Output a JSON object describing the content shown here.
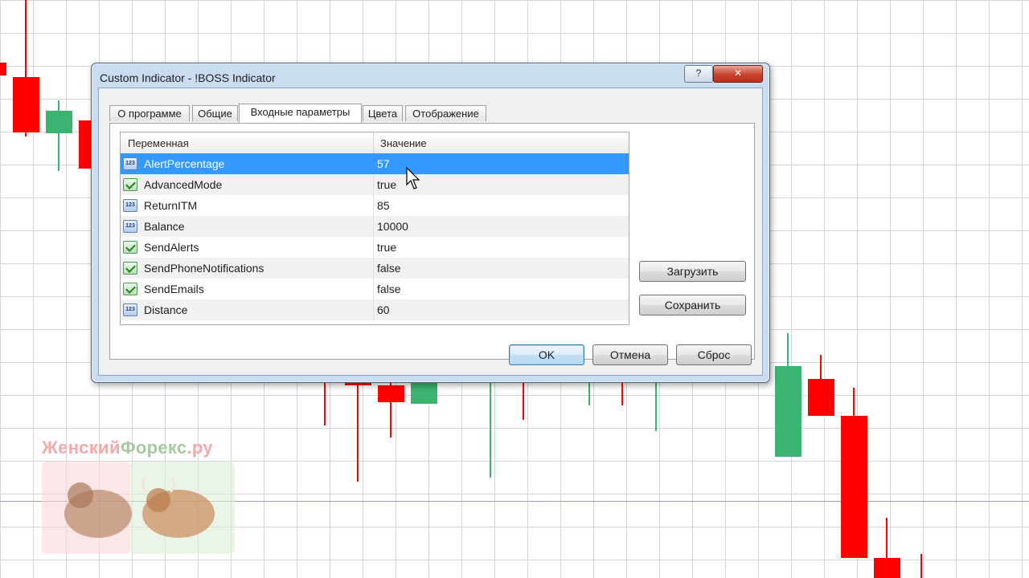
{
  "dialog": {
    "title": "Custom Indicator - !BOSS Indicator",
    "help_label": "?",
    "close_label": "✕"
  },
  "tabs": [
    {
      "label": "О программе",
      "active": false
    },
    {
      "label": "Общие",
      "active": false
    },
    {
      "label": "Входные параметры",
      "active": true
    },
    {
      "label": "Цвета",
      "active": false
    },
    {
      "label": "Отображение",
      "active": false
    }
  ],
  "table": {
    "headers": [
      "Переменная",
      "Значение"
    ],
    "rows": [
      {
        "icon": "number-icon",
        "name": "AlertPercentage",
        "value": "57",
        "selected": true
      },
      {
        "icon": "bool-icon",
        "name": "AdvancedMode",
        "value": "true",
        "selected": false
      },
      {
        "icon": "number-icon",
        "name": "ReturnITM",
        "value": "85",
        "selected": false
      },
      {
        "icon": "number-icon",
        "name": "Balance",
        "value": "10000",
        "selected": false
      },
      {
        "icon": "bool-icon",
        "name": "SendAlerts",
        "value": "true",
        "selected": false
      },
      {
        "icon": "bool-icon",
        "name": "SendPhoneNotifications",
        "value": "false",
        "selected": false
      },
      {
        "icon": "bool-icon",
        "name": "SendEmails",
        "value": "false",
        "selected": false
      },
      {
        "icon": "number-icon",
        "name": "Distance",
        "value": "60",
        "selected": false
      }
    ],
    "number_icon_text": "123"
  },
  "side_buttons": {
    "load": "Загрузить",
    "save": "Сохранить"
  },
  "footer_buttons": {
    "ok": "OK",
    "cancel": "Отмена",
    "reset": "Сброс"
  },
  "watermark": {
    "part1": "Женский",
    "part2": "Форекс",
    "part3": ".ру"
  },
  "colors": {
    "bull": "#3cb371",
    "bear": "#ff0000",
    "selection": "#3399ff"
  }
}
